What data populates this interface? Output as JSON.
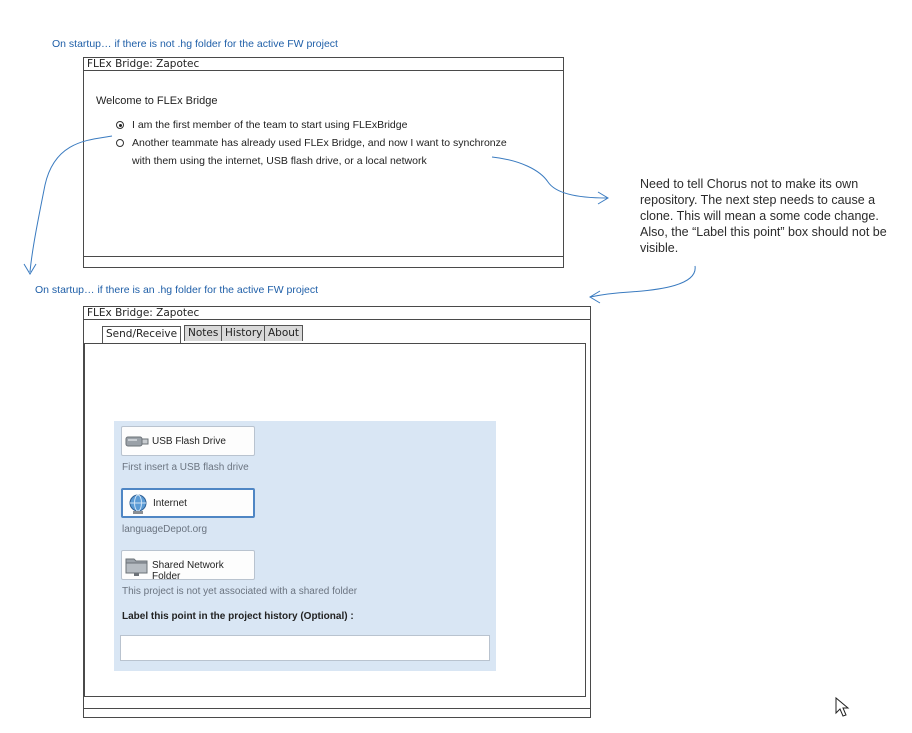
{
  "captions": {
    "top": "On startup… if there is not .hg folder for the active FW project",
    "middle": "On startup… if there is an .hg folder for the active FW project"
  },
  "note": {
    "text": "Need to tell Chorus not to make its own repository. The next step needs to cause a clone. This will mean a some code change. Also, the “Label this point” box should not be visible."
  },
  "window1": {
    "title": "FLEx Bridge: Zapotec",
    "welcome": "Welcome to FLEx Bridge",
    "option1": "I am the first member of the team to start using FLExBridge",
    "option2_line1": "Another teammate has already used FLEx Bridge, and now I want to synchronze",
    "option2_line2": "with them using the internet, USB flash drive, or a local network"
  },
  "window2": {
    "title": "FLEx Bridge: Zapotec",
    "tabs": [
      {
        "label": "Send/Receive"
      },
      {
        "label": "Notes"
      },
      {
        "label": "History"
      },
      {
        "label": "About"
      }
    ],
    "usb": {
      "label": "USB Flash Drive",
      "desc": "First insert a USB flash drive"
    },
    "internet": {
      "label": "Internet",
      "desc": "languageDepot.org"
    },
    "network": {
      "label": "Shared Network Folder",
      "desc": "This project is not yet associated with a shared folder"
    },
    "history_label": "Label this point in the project history (Optional) :",
    "history_value": ""
  },
  "icons": {
    "usb": "usb-drive-icon",
    "internet": "globe-icon",
    "network": "network-folder-icon",
    "cursor": "mouse-pointer-icon"
  },
  "colors": {
    "caption": "#1f5fa8",
    "arrow": "#3a7bc0",
    "panel": "#d9e6f4",
    "focus": "#4f86c4"
  }
}
